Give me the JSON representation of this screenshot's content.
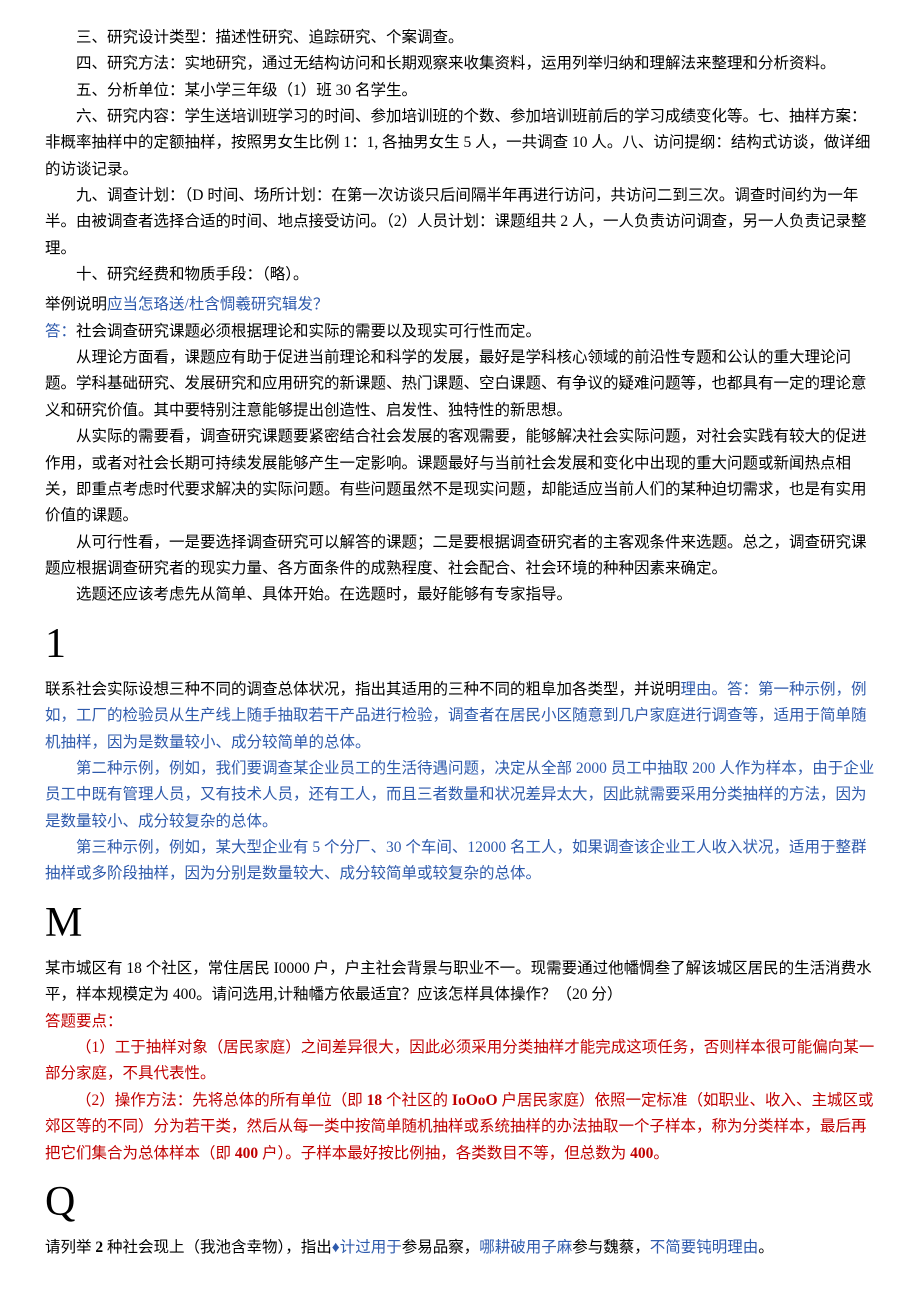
{
  "top": {
    "p1": "三、研究设计类型：描述性研究、追踪研究、个案调查。",
    "p2": "四、研究方法：实地研究，通过无结构访问和长期观察来收集资料，运用列举归纳和理解法来整理和分析资料。",
    "p3": "五、分析单位：某小学三年级（1）班 30 名学生。",
    "p4": "六、研究内容：学生送培训班学习的时间、参加培训班的个数、参加培训班前后的学习成绩变化等。七、抽样方案：非概率抽样中的定额抽样，按照男女生比例 1：1, 各抽男女生 5 人，一共调查 10 人。八、访问提纲：结构式访谈，做详细的访谈记录。",
    "p5": "九、调查计划：（D 时间、场所计划：在第一次访谈只后间隔半年再进行访问，共访问二到三次。调查时间约为一年半。由被调查者选择合适的时间、地点接受访问。（2）人员计划：课题组共 2 人，一人负责访问调查，另一人负责记录整理。",
    "p6": "十、研究经费和物质手段：（略）。"
  },
  "q1": {
    "prefix": "举例说明",
    "link": "应当怎珞送/杜含惆羲研究辑发？",
    "a_prefix": "答：",
    "a1": "社会调查研究课题必须根据理论和实际的需要以及现实可行性而定。",
    "a2": "从理论方面看，课题应有助于促进当前理论和科学的发展，最好是学科核心领域的前沿性专题和公认的重大理论问题。学科基础研究、发展研究和应用研究的新课题、热门课题、空白课题、有争议的疑难问题等，也都具有一定的理论意义和研究价值。其中要特别注意能够提出创造性、启发性、独特性的新思想。",
    "a3": "从实际的需要看，调查研究课题要紧密结合社会发展的客观需要，能够解决社会实际问题，对社会实践有较大的促进作用，或者对社会长期可持续发展能够产生一定影响。课题最好与当前社会发展和变化中出现的重大问题或新闻热点相关，即重点考虑时代要求解决的实际问题。有些问题虽然不是现实问题，却能适应当前人们的某种迫切需求，也是有实用价值的课题。",
    "a4": "从可行性看，一是要选择调查研究可以解答的课题；二是要根据调查研究者的主客观条件来选题。总之，调查研究课题应根据调查研究者的现实力量、各方面条件的成熟程度、社会配合、社会环境的种种因素来确定。",
    "a5": "选题还应该考虑先从简单、具体开始。在选题时，最好能够有专家指导。"
  },
  "letter1": "1",
  "q2": {
    "pre": "联系社会实际设想三种不同的调查总体状况，指出其适用的三种不同的粗阜加各类型，并说明",
    "link": "理由",
    "after": "。答：第一种示例，例如，工厂的检验员从生产线上随手抽取若干产品进行检验，调查者在居民小区随意到几户家庭进行调查等，适用于简单随机抽样，因为是数量较小、成分较简单的总体。",
    "a2": "第二种示例，例如，我们要调查某企业员工的生活待遇问题，决定从全部 2000 员工中抽取 200 人作为样本，由于企业员工中既有管理人员，又有技术人员，还有工人，而且三者数量和状况差异太大，因此就需要采用分类抽样的方法，因为是数量较小、成分较复杂的总体。",
    "a3": "第三种示例，例如，某大型企业有 5 个分厂、30 个车间、12000 名工人，如果调查该企业工人收入状况，适用于整群抽样或多阶段抽样，因为分别是数量较大、成分较简单或较复杂的总体。"
  },
  "letterM": "M",
  "q3": {
    "q": "某市城区有 18 个社区，常住居民 I0000 户，户主社会背景与职业不一。现需要通过他幡惆叁了解该城区居民的生活消费水平，样本规模定为 400。请问选用,计釉幡方依最适宜？应该怎样具体操作？（20 分）",
    "key": "答题要点：",
    "a1": "（1）工于抽样对象（居民家庭）之间差异很大，因此必须采用分类抽样才能完成这项任务，否则样本很可能偏向某一部分家庭，不具代表性。",
    "a2_pre": "（2）操作方法：先将总体的所有单位（即 ",
    "a2_b1": "18",
    "a2_mid1": " 个社区的 ",
    "a2_b2": "IoOoO",
    "a2_mid2": " 户居民家庭）依照一定标准（如职业、收入、主城区或郊区等的不同）分为若干类，然后从每一类中按简单随机抽样或系统抽样的办法抽取一个子样本，称为分类样本，最后再把它们集合为总体样本（即 ",
    "a2_b3": "400",
    "a2_mid3": " 户）。子样本最好按比例抽，各类数目不等，但总数为 ",
    "a2_b4": "400",
    "a2_end": "。"
  },
  "letterQ": "Q",
  "q4": {
    "p1": "请列举 ",
    "b1": "2",
    "p2": " 种社会现上（我池含幸物），指出",
    "diamond": "♦",
    "link1": "计过用于",
    "p3": "参易品察，",
    "link2": "哪耕破用子麻",
    "p4": "参与魏蔡，",
    "link3": "不简要钝明理由",
    "p5": "。"
  }
}
